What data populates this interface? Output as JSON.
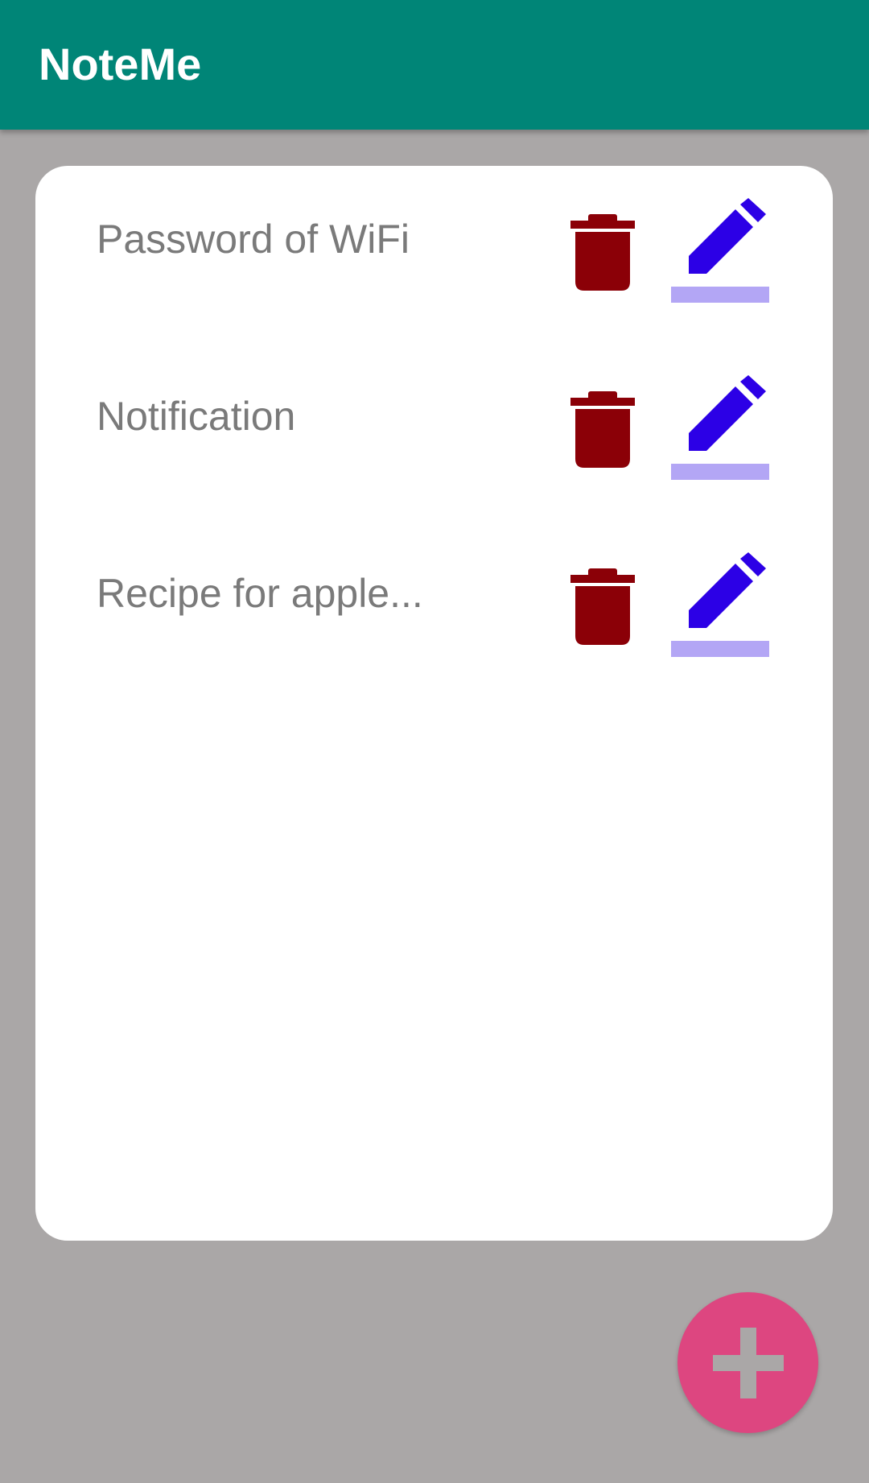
{
  "app_bar": {
    "title": "NoteMe"
  },
  "notes": [
    {
      "title": "Password of WiFi"
    },
    {
      "title": "Notification"
    },
    {
      "title": "Recipe for apple..."
    }
  ],
  "icons": {
    "delete": "trash-icon",
    "edit": "pencil-icon",
    "add": "plus-icon"
  },
  "colors": {
    "app_bar": "#008577",
    "background": "#aaa7a7",
    "delete_icon": "#8b0007",
    "edit_icon": "#2c00e6",
    "edit_underline": "#b3a6f5",
    "fab": "#dd4680",
    "fab_icon": "#aaa7a7",
    "note_text": "#7a7a7a"
  }
}
